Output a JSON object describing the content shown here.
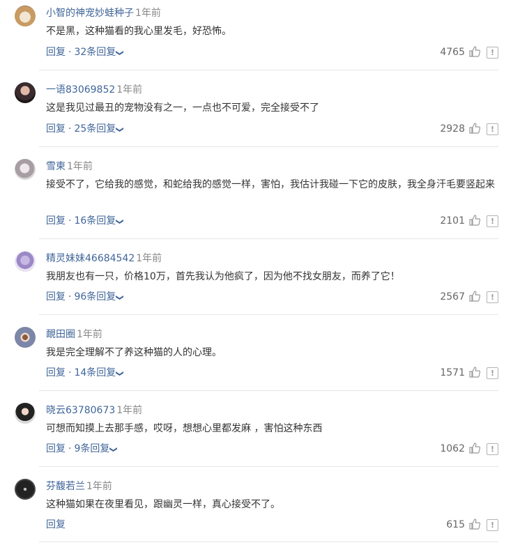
{
  "comments": [
    {
      "username": "小智的神宠妙蛙种子",
      "time": "1年前",
      "text": "不是黑，这种猫看的我心里发毛，好恐怖。",
      "reply": "回复",
      "dot": "·",
      "replies_count": "32条回复",
      "likes": "4765"
    },
    {
      "username": "一语83069852",
      "time": "1年前",
      "text": "这是我见过最丑的宠物没有之一，一点也不可爱，完全接受不了",
      "reply": "回复",
      "dot": "·",
      "replies_count": "25条回复",
      "likes": "2928"
    },
    {
      "username": "雪柬",
      "time": "1年前",
      "text": "接受不了，它给我的感觉，和蛇给我的感觉一样，害怕，我估计我碰一下它的皮肤，我全身汗毛要竖起来",
      "reply": "回复",
      "dot": "·",
      "replies_count": "16条回复",
      "likes": "2101"
    },
    {
      "username": "精灵妹妹46684542",
      "time": "1年前",
      "text": "我朋友也有一只，价格10万，首先我认为他疯了，因为他不找女朋友，而养了它！",
      "reply": "回复",
      "dot": "·",
      "replies_count": "96条回复",
      "likes": "2567"
    },
    {
      "username": "靦田圈",
      "time": "1年前",
      "text": "我是完全理解不了养这种猫的人的心理。",
      "reply": "回复",
      "dot": "·",
      "replies_count": "14条回复",
      "likes": "1571"
    },
    {
      "username": "晓云63780673",
      "time": "1年前",
      "text": "可想而知摸上去那手感，哎呀，想想心里都发麻 ，害怕这种东西",
      "reply": "回复",
      "dot": "·",
      "replies_count": "9条回复",
      "likes": "1062"
    },
    {
      "username": "芬馥若兰",
      "time": "1年前",
      "text": "这种猫如果在夜里看见，跟幽灵一样，真心接受不了。",
      "reply": "回复",
      "likes": "615"
    }
  ],
  "icons": {
    "like": "thumbs-up-icon",
    "report": "report-icon",
    "expand": "chevron-down-icon"
  },
  "report_glyph": "!",
  "colors": {
    "link": "#406599",
    "text": "#333333",
    "meta": "#888888",
    "divider": "#e6e6e6"
  }
}
